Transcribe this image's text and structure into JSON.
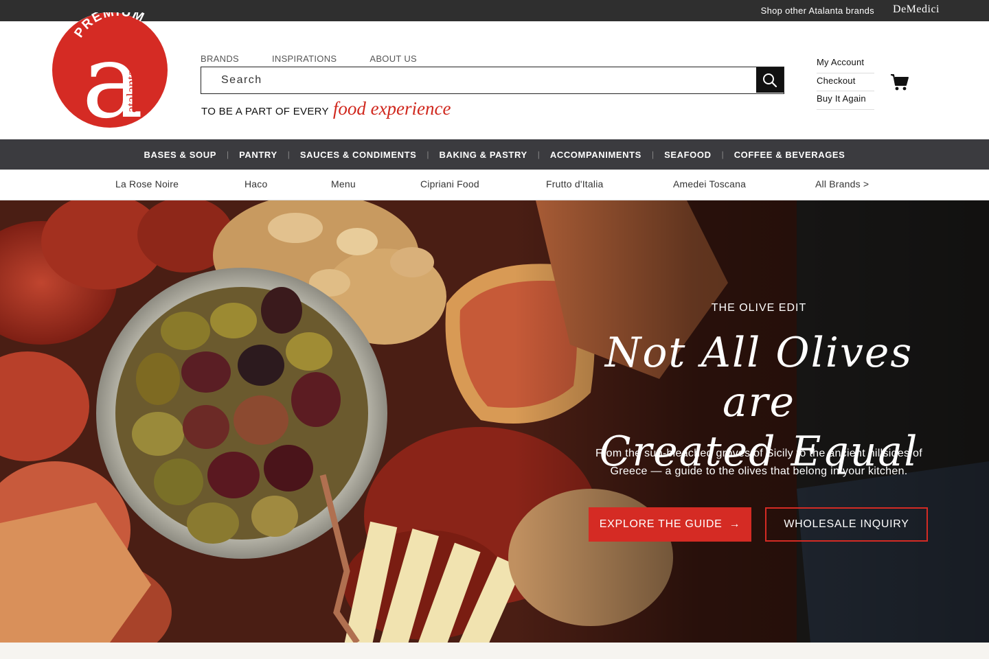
{
  "topbar": {
    "shop_text": "Shop other Atalanta brands",
    "brand": "DeMedici"
  },
  "logo": {
    "top_text": "PREMIUM",
    "letter": "a",
    "side_text": "atalanta",
    "color": "#d52b24"
  },
  "secondary_nav": [
    "BRANDS",
    "INSPIRATIONS",
    "ABOUT US"
  ],
  "search": {
    "placeholder": "Search",
    "icon": "search-icon"
  },
  "tagline": {
    "lead": "TO BE A PART OF EVERY",
    "emphasis": "food experience"
  },
  "account": {
    "items": [
      "My Account",
      "Checkout",
      "Buy It Again"
    ],
    "cart_icon": "cart-icon"
  },
  "categories": [
    "BASES & SOUP",
    "PANTRY",
    "SAUCES & CONDIMENTS",
    "BAKING & PASTRY",
    "ACCOMPANIMENTS",
    "SEAFOOD",
    "COFFEE & BEVERAGES"
  ],
  "brands": [
    "La Rose Noire",
    "Haco",
    "Menu",
    "Cipriani Food",
    "Frutto d'Italia",
    "Amedei Toscana",
    "All Brands >"
  ],
  "hero": {
    "eyebrow": "THE OLIVE EDIT",
    "headline_line1": "Not All Olives are",
    "headline_line2": "Created Equal",
    "subtext": "From the sun-bleached groves of Sicily to the ancient hillsides of Greece — a guide to the olives that belong in your kitchen.",
    "primary_button": "EXPLORE THE GUIDE",
    "primary_arrow": "→",
    "secondary_button": "WHOLESALE INQUIRY"
  },
  "colors": {
    "accent": "#d52b24",
    "topbar": "#2f2f2f",
    "catnav": "#3b3b3f"
  }
}
